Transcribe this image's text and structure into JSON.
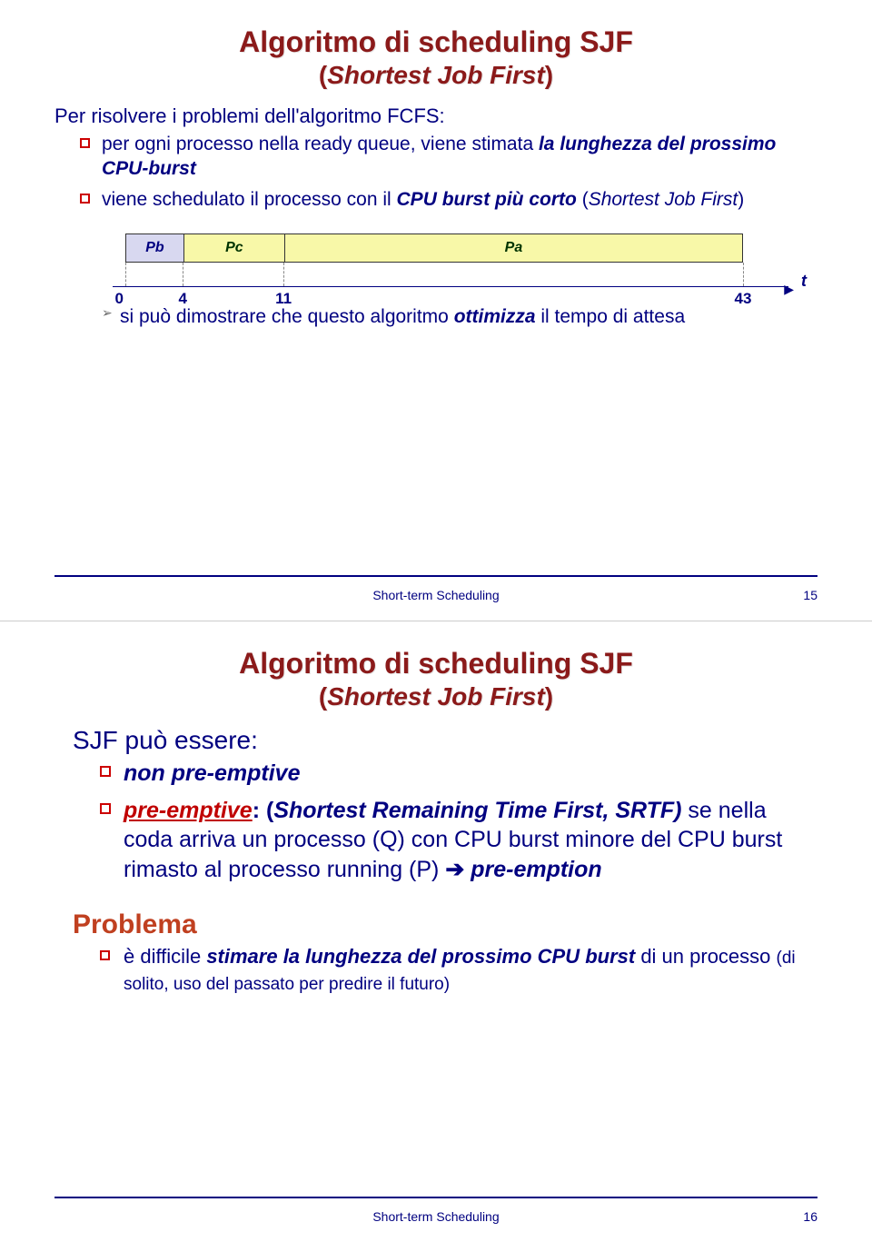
{
  "slide1": {
    "title": "Algoritmo di scheduling SJF",
    "subtitle_open": "(",
    "subtitle_inner": "Shortest Job First",
    "subtitle_close": ")",
    "intro": "Per risolvere i problemi dell'algoritmo FCFS:",
    "b1_a": "per ogni processo nella ready queue, viene stimata ",
    "b1_b": "la lunghezza del prossimo CPU-burst",
    "b2_a": " viene schedulato il processo con il ",
    "b2_b": "CPU burst più corto",
    "b2_c": " (",
    "b2_d": "Shortest Job First",
    "b2_e": ")",
    "sub_a": "si può dimostrare che questo algoritmo ",
    "sub_b": "ottimizza",
    "sub_c": " il tempo di attesa",
    "t_label": "t",
    "footer": "Short-term Scheduling",
    "page": "15"
  },
  "chart_data": {
    "type": "bar",
    "orientation": "horizontal-timeline",
    "xlabel": "t",
    "segments": [
      {
        "name": "Pb",
        "start": 0,
        "end": 4
      },
      {
        "name": "Pc",
        "start": 4,
        "end": 11
      },
      {
        "name": "Pa",
        "start": 11,
        "end": 43
      }
    ],
    "ticks": [
      0,
      4,
      11,
      43
    ]
  },
  "slide2": {
    "title": "Algoritmo di scheduling SJF",
    "subtitle_open": "(",
    "subtitle_inner": "Shortest Job First",
    "subtitle_close": ")",
    "body": "SJF può essere:",
    "b1": "non pre-emptive",
    "b2_a": "pre-emptive",
    "b2_b": ": (",
    "b2_c": "Shortest Remaining Time First, SRTF)",
    "b2_d": " se nella coda arriva un processo (Q) con CPU burst minore del CPU burst rimasto al processo running (P) ",
    "b2_arrow": "➔",
    "b2_e": " pre-emption",
    "problema": "Problema",
    "p1_a": "è difficile ",
    "p1_b": "stimare la lunghezza del prossimo CPU burst",
    "p1_c": " di un processo ",
    "p1_d": "(di solito, uso del passato per predire il futuro)",
    "footer": "Short-term Scheduling",
    "page": "16"
  }
}
